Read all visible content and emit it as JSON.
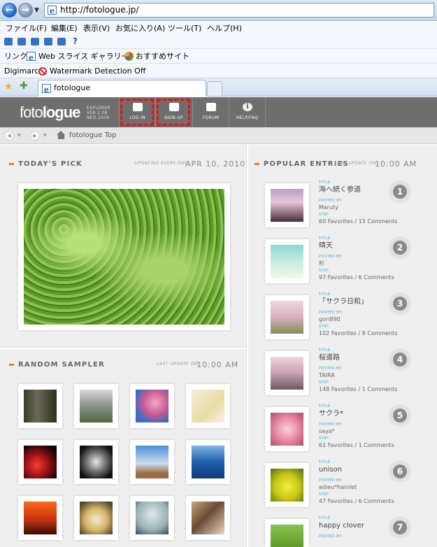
{
  "browser": {
    "url": "http://fotologue.jp/",
    "menu": [
      "ファイル(F)",
      "編集(E)",
      "表示(V)",
      "お気に入り(A)",
      "ツール(T)",
      "ヘルプ(H)"
    ],
    "links_label": "リンク",
    "links": [
      "Web スライス ギャラリー",
      "おすすめサイト"
    ],
    "digimarc_label": "Digimarc",
    "digimarc_status": "Watermark Detection Off",
    "tab_title": "fotologue"
  },
  "site": {
    "logo_light": "foto",
    "logo_bold": "logue",
    "logo_sub": [
      "EXPLORER",
      "VER.2.08",
      "NEO.2009"
    ],
    "nav": [
      "LOG IN",
      "SIGN UP",
      "FORUM",
      "HELP/FAQ"
    ],
    "breadcrumb": "fotologue Top"
  },
  "todays_pick": {
    "title": "TODAY'S PICK",
    "meta": "UPDATING EVERY DAY :",
    "date": "APR 10, 2010"
  },
  "random_sampler": {
    "title": "RANDOM SAMPLER",
    "meta": "LAST UPDATE ON :",
    "time": "10:00 AM"
  },
  "popular": {
    "title": "POPULAR ENTRIES",
    "meta": "LAST UPDATE ON :",
    "time": "10:00 AM",
    "labels": {
      "title": "TITLE:",
      "posted_by": "POSTED BY:",
      "stat": "STAT:"
    },
    "entries": [
      {
        "rank": "1",
        "title": "海へ続く参道",
        "by": "Maruty",
        "stat": "60 Favorites / 15 Comments"
      },
      {
        "rank": "2",
        "title": "晴天",
        "by": "杉",
        "stat": "97 Favorites / 6 Comments"
      },
      {
        "rank": "3",
        "title": "「サクラ日和」",
        "by": "gori890",
        "stat": "102 Favorites / 8 Comments"
      },
      {
        "rank": "4",
        "title": "桜道路",
        "by": "TAIRA",
        "stat": "148 Favorites / 1 Comments"
      },
      {
        "rank": "5",
        "title": "サクラ*",
        "by": "saya*",
        "stat": "61 Favorites / 1 Comments"
      },
      {
        "rank": "6",
        "title": "unison",
        "by": "adieu*hamlet",
        "stat": "47 Favorites / 6 Comments"
      },
      {
        "rank": "7",
        "title": "happy clover",
        "by": "",
        "stat": ""
      }
    ]
  },
  "colors": {
    "accent": "#f07a1a",
    "header": "#6e6e6e",
    "label": "#4aa3bf",
    "highlight": "#ee1111"
  }
}
